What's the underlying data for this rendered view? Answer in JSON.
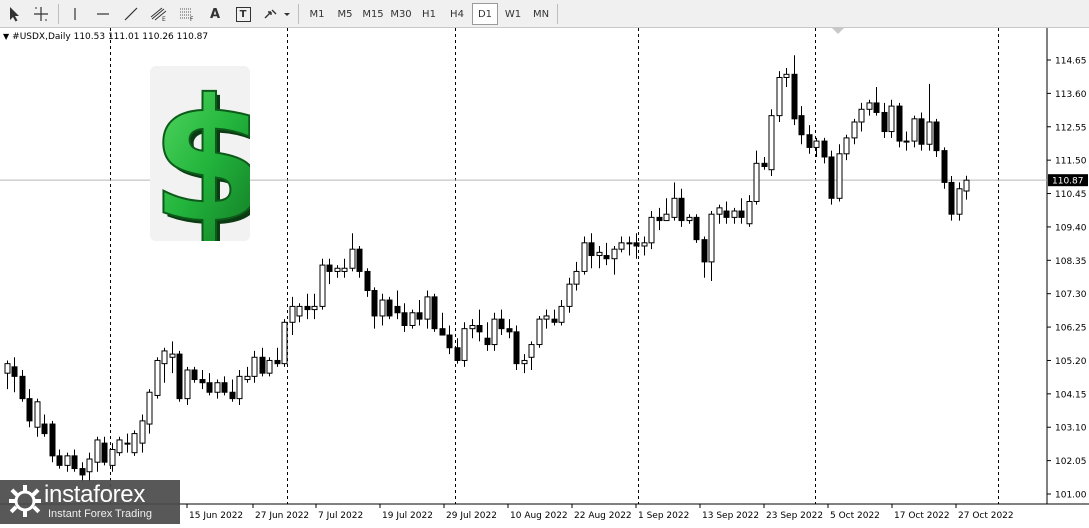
{
  "toolbar": {
    "tools": [
      {
        "icon": "cursor-arrow-icon"
      },
      {
        "icon": "crosshair-icon"
      },
      {
        "icon": "vertical-line-icon"
      },
      {
        "icon": "horizontal-line-icon"
      },
      {
        "icon": "trendline-icon"
      },
      {
        "icon": "equidistant-channel-icon"
      },
      {
        "icon": "fibonacci-icon"
      },
      {
        "icon": "text-icon",
        "label": "A"
      },
      {
        "icon": "text-label-icon",
        "label": "T"
      },
      {
        "icon": "arrows-dropdown-icon"
      }
    ],
    "timeframes": [
      "M1",
      "M5",
      "M15",
      "M30",
      "H1",
      "H4",
      "D1",
      "W1",
      "MN"
    ],
    "active_timeframe": "D1"
  },
  "symbol_info": "#USDX,Daily  110.53 111.01 110.26 110.87",
  "watermark": {
    "brand": "instaforex",
    "tagline": "Instant Forex Trading"
  },
  "colors": {
    "bull_body": "#ffffff",
    "bear_body": "#000000",
    "wick": "#000000",
    "price_tag_bg": "#000000",
    "price_tag_fg": "#ffffff",
    "dollar_green": "#22b43c"
  },
  "chart_data": {
    "type": "candlestick",
    "symbol": "#USDX",
    "timeframe": "Daily",
    "ohlc_current": {
      "open": 110.53,
      "high": 111.01,
      "low": 110.26,
      "close": 110.87
    },
    "ylim": [
      101.0,
      114.9
    ],
    "y_ticks": [
      101.0,
      102.05,
      103.1,
      104.15,
      105.2,
      106.25,
      107.3,
      108.35,
      109.4,
      110.45,
      111.5,
      112.55,
      113.6,
      114.65
    ],
    "y_tick_labels": [
      "101.00",
      "102.05",
      "103.10",
      "104.15",
      "105.20",
      "106.25",
      "107.30",
      "108.35",
      "109.40",
      "110.45",
      "111.50",
      "112.55",
      "113.60",
      "114.65"
    ],
    "current_price": "110.87",
    "x_tick_labels": [
      "15 Jun 2022",
      "27 Jun 2022",
      "7 Jul 2022",
      "19 Jul 2022",
      "29 Jul 2022",
      "10 Aug 2022",
      "22 Aug 2022",
      "1 Sep 2022",
      "13 Sep 2022",
      "23 Sep 2022",
      "5 Oct 2022",
      "17 Oct 2022",
      "27 Oct 2022"
    ],
    "grid": "off",
    "candles": [
      {
        "o": 104.8,
        "h": 105.2,
        "l": 104.3,
        "c": 105.1
      },
      {
        "o": 105.0,
        "h": 105.3,
        "l": 104.2,
        "c": 104.7
      },
      {
        "o": 104.7,
        "h": 104.9,
        "l": 103.9,
        "c": 104.0
      },
      {
        "o": 104.0,
        "h": 104.3,
        "l": 103.1,
        "c": 103.3
      },
      {
        "o": 103.1,
        "h": 104.0,
        "l": 102.8,
        "c": 103.9
      },
      {
        "o": 103.2,
        "h": 103.5,
        "l": 102.8,
        "c": 102.9
      },
      {
        "o": 103.2,
        "h": 103.3,
        "l": 102.0,
        "c": 102.2
      },
      {
        "o": 102.2,
        "h": 102.4,
        "l": 101.8,
        "c": 101.9
      },
      {
        "o": 101.9,
        "h": 102.3,
        "l": 101.7,
        "c": 102.2
      },
      {
        "o": 102.2,
        "h": 102.4,
        "l": 101.7,
        "c": 101.8
      },
      {
        "o": 101.8,
        "h": 102.0,
        "l": 101.4,
        "c": 101.6
      },
      {
        "o": 101.7,
        "h": 102.3,
        "l": 101.4,
        "c": 102.1
      },
      {
        "o": 102.0,
        "h": 102.8,
        "l": 101.7,
        "c": 102.7
      },
      {
        "o": 102.6,
        "h": 102.8,
        "l": 101.9,
        "c": 102.0
      },
      {
        "o": 101.9,
        "h": 102.6,
        "l": 101.7,
        "c": 102.4
      },
      {
        "o": 102.3,
        "h": 102.8,
        "l": 102.2,
        "c": 102.7
      },
      {
        "o": 102.6,
        "h": 102.9,
        "l": 102.3,
        "c": 102.6
      },
      {
        "o": 102.3,
        "h": 103.0,
        "l": 102.2,
        "c": 102.9
      },
      {
        "o": 102.6,
        "h": 103.5,
        "l": 102.3,
        "c": 103.3
      },
      {
        "o": 103.2,
        "h": 104.3,
        "l": 102.9,
        "c": 104.2
      },
      {
        "o": 104.1,
        "h": 105.3,
        "l": 104.0,
        "c": 105.2
      },
      {
        "o": 105.1,
        "h": 105.6,
        "l": 104.5,
        "c": 105.5
      },
      {
        "o": 105.3,
        "h": 105.8,
        "l": 104.8,
        "c": 105.4
      },
      {
        "o": 105.4,
        "h": 105.5,
        "l": 103.9,
        "c": 104.0
      },
      {
        "o": 104.0,
        "h": 105.0,
        "l": 103.8,
        "c": 104.9
      },
      {
        "o": 104.9,
        "h": 105.0,
        "l": 104.5,
        "c": 104.6
      },
      {
        "o": 104.6,
        "h": 104.9,
        "l": 104.3,
        "c": 104.5
      },
      {
        "o": 104.5,
        "h": 104.8,
        "l": 104.1,
        "c": 104.2
      },
      {
        "o": 104.2,
        "h": 104.6,
        "l": 104.0,
        "c": 104.5
      },
      {
        "o": 104.5,
        "h": 104.7,
        "l": 104.1,
        "c": 104.2
      },
      {
        "o": 104.2,
        "h": 104.6,
        "l": 103.9,
        "c": 104.0
      },
      {
        "o": 104.0,
        "h": 104.9,
        "l": 103.8,
        "c": 104.7
      },
      {
        "o": 104.6,
        "h": 105.0,
        "l": 104.5,
        "c": 104.7
      },
      {
        "o": 104.7,
        "h": 105.5,
        "l": 104.5,
        "c": 105.3
      },
      {
        "o": 105.3,
        "h": 105.6,
        "l": 104.7,
        "c": 104.8
      },
      {
        "o": 104.8,
        "h": 105.3,
        "l": 104.7,
        "c": 105.2
      },
      {
        "o": 105.2,
        "h": 105.6,
        "l": 105.0,
        "c": 105.1
      },
      {
        "o": 105.1,
        "h": 106.5,
        "l": 105.0,
        "c": 106.4
      },
      {
        "o": 106.4,
        "h": 107.2,
        "l": 106.0,
        "c": 106.9
      },
      {
        "o": 106.6,
        "h": 107.0,
        "l": 106.4,
        "c": 106.9
      },
      {
        "o": 106.9,
        "h": 107.3,
        "l": 106.5,
        "c": 106.8
      },
      {
        "o": 106.8,
        "h": 107.3,
        "l": 106.5,
        "c": 106.9
      },
      {
        "o": 106.9,
        "h": 108.4,
        "l": 106.8,
        "c": 108.2
      },
      {
        "o": 108.2,
        "h": 108.4,
        "l": 107.6,
        "c": 108.0
      },
      {
        "o": 108.0,
        "h": 108.2,
        "l": 107.8,
        "c": 108.1
      },
      {
        "o": 108.0,
        "h": 108.4,
        "l": 107.8,
        "c": 108.1
      },
      {
        "o": 108.1,
        "h": 109.2,
        "l": 108.0,
        "c": 108.7
      },
      {
        "o": 108.7,
        "h": 108.8,
        "l": 107.8,
        "c": 108.0
      },
      {
        "o": 108.0,
        "h": 108.1,
        "l": 107.2,
        "c": 107.4
      },
      {
        "o": 107.4,
        "h": 107.5,
        "l": 106.2,
        "c": 106.6
      },
      {
        "o": 106.6,
        "h": 107.3,
        "l": 106.3,
        "c": 107.1
      },
      {
        "o": 107.1,
        "h": 107.2,
        "l": 106.5,
        "c": 106.6
      },
      {
        "o": 106.9,
        "h": 107.4,
        "l": 106.5,
        "c": 106.7
      },
      {
        "o": 106.7,
        "h": 107.0,
        "l": 106.1,
        "c": 106.3
      },
      {
        "o": 106.3,
        "h": 106.8,
        "l": 106.2,
        "c": 106.7
      },
      {
        "o": 106.7,
        "h": 107.1,
        "l": 106.3,
        "c": 106.5
      },
      {
        "o": 106.5,
        "h": 107.4,
        "l": 106.2,
        "c": 107.2
      },
      {
        "o": 107.2,
        "h": 107.3,
        "l": 106.1,
        "c": 106.2
      },
      {
        "o": 106.2,
        "h": 106.7,
        "l": 106.0,
        "c": 106.0
      },
      {
        "o": 106.0,
        "h": 106.3,
        "l": 105.4,
        "c": 105.6
      },
      {
        "o": 105.6,
        "h": 105.9,
        "l": 105.1,
        "c": 105.2
      },
      {
        "o": 105.2,
        "h": 106.4,
        "l": 105.0,
        "c": 106.2
      },
      {
        "o": 106.2,
        "h": 106.5,
        "l": 105.9,
        "c": 106.3
      },
      {
        "o": 106.3,
        "h": 106.8,
        "l": 105.8,
        "c": 106.1
      },
      {
        "o": 105.9,
        "h": 106.4,
        "l": 105.5,
        "c": 105.7
      },
      {
        "o": 105.7,
        "h": 106.7,
        "l": 105.5,
        "c": 106.5
      },
      {
        "o": 106.5,
        "h": 106.8,
        "l": 106.0,
        "c": 106.2
      },
      {
        "o": 106.2,
        "h": 106.5,
        "l": 105.9,
        "c": 106.1
      },
      {
        "o": 106.1,
        "h": 106.3,
        "l": 104.9,
        "c": 105.1
      },
      {
        "o": 105.1,
        "h": 105.4,
        "l": 104.8,
        "c": 105.2
      },
      {
        "o": 105.3,
        "h": 105.8,
        "l": 104.9,
        "c": 105.7
      },
      {
        "o": 105.7,
        "h": 106.6,
        "l": 105.6,
        "c": 106.5
      },
      {
        "o": 106.5,
        "h": 106.8,
        "l": 106.2,
        "c": 106.6
      },
      {
        "o": 106.5,
        "h": 106.8,
        "l": 106.3,
        "c": 106.4
      },
      {
        "o": 106.4,
        "h": 107.1,
        "l": 106.3,
        "c": 106.9
      },
      {
        "o": 106.9,
        "h": 107.8,
        "l": 106.7,
        "c": 107.6
      },
      {
        "o": 107.6,
        "h": 108.3,
        "l": 107.4,
        "c": 108.0
      },
      {
        "o": 108.0,
        "h": 109.1,
        "l": 107.9,
        "c": 108.9
      },
      {
        "o": 108.9,
        "h": 109.2,
        "l": 108.1,
        "c": 108.5
      },
      {
        "o": 108.5,
        "h": 108.8,
        "l": 108.1,
        "c": 108.6
      },
      {
        "o": 108.5,
        "h": 108.9,
        "l": 108.2,
        "c": 108.4
      },
      {
        "o": 108.4,
        "h": 108.8,
        "l": 107.9,
        "c": 108.7
      },
      {
        "o": 108.7,
        "h": 109.1,
        "l": 108.6,
        "c": 108.9
      },
      {
        "o": 108.9,
        "h": 109.1,
        "l": 108.5,
        "c": 108.9
      },
      {
        "o": 108.9,
        "h": 109.2,
        "l": 108.4,
        "c": 108.8
      },
      {
        "o": 108.8,
        "h": 109.1,
        "l": 108.5,
        "c": 108.9
      },
      {
        "o": 108.9,
        "h": 109.9,
        "l": 108.7,
        "c": 109.7
      },
      {
        "o": 109.7,
        "h": 110.0,
        "l": 109.3,
        "c": 109.6
      },
      {
        "o": 109.6,
        "h": 110.3,
        "l": 109.6,
        "c": 109.8
      },
      {
        "o": 109.7,
        "h": 110.8,
        "l": 109.6,
        "c": 110.3
      },
      {
        "o": 110.3,
        "h": 110.6,
        "l": 109.4,
        "c": 109.6
      },
      {
        "o": 109.6,
        "h": 109.8,
        "l": 109.5,
        "c": 109.7
      },
      {
        "o": 109.7,
        "h": 109.8,
        "l": 108.9,
        "c": 109.0
      },
      {
        "o": 109.0,
        "h": 109.1,
        "l": 107.8,
        "c": 108.3
      },
      {
        "o": 108.3,
        "h": 109.9,
        "l": 107.7,
        "c": 109.8
      },
      {
        "o": 109.8,
        "h": 110.1,
        "l": 109.5,
        "c": 110.0
      },
      {
        "o": 109.9,
        "h": 110.2,
        "l": 109.5,
        "c": 109.7
      },
      {
        "o": 109.7,
        "h": 110.0,
        "l": 109.5,
        "c": 109.9
      },
      {
        "o": 109.9,
        "h": 110.3,
        "l": 109.5,
        "c": 109.7
      },
      {
        "o": 109.5,
        "h": 110.4,
        "l": 109.4,
        "c": 110.2
      },
      {
        "o": 110.2,
        "h": 111.8,
        "l": 110.1,
        "c": 111.4
      },
      {
        "o": 111.4,
        "h": 111.6,
        "l": 111.2,
        "c": 111.3
      },
      {
        "o": 111.2,
        "h": 113.1,
        "l": 111.0,
        "c": 112.9
      },
      {
        "o": 112.9,
        "h": 114.3,
        "l": 112.7,
        "c": 114.1
      },
      {
        "o": 114.1,
        "h": 114.4,
        "l": 113.8,
        "c": 114.2
      },
      {
        "o": 114.2,
        "h": 114.8,
        "l": 112.6,
        "c": 112.8
      },
      {
        "o": 112.9,
        "h": 113.2,
        "l": 112.0,
        "c": 112.3
      },
      {
        "o": 112.3,
        "h": 112.6,
        "l": 111.7,
        "c": 111.9
      },
      {
        "o": 111.9,
        "h": 112.2,
        "l": 111.6,
        "c": 112.1
      },
      {
        "o": 112.1,
        "h": 112.2,
        "l": 111.4,
        "c": 111.6
      },
      {
        "o": 111.6,
        "h": 111.8,
        "l": 110.1,
        "c": 110.3
      },
      {
        "o": 110.3,
        "h": 112.0,
        "l": 110.2,
        "c": 111.7
      },
      {
        "o": 111.7,
        "h": 112.3,
        "l": 111.5,
        "c": 112.2
      },
      {
        "o": 112.2,
        "h": 112.8,
        "l": 112.0,
        "c": 112.7
      },
      {
        "o": 112.7,
        "h": 113.3,
        "l": 112.4,
        "c": 113.1
      },
      {
        "o": 113.1,
        "h": 113.4,
        "l": 112.9,
        "c": 113.3
      },
      {
        "o": 113.3,
        "h": 113.8,
        "l": 112.9,
        "c": 113.0
      },
      {
        "o": 113.0,
        "h": 113.3,
        "l": 112.2,
        "c": 112.4
      },
      {
        "o": 112.4,
        "h": 113.4,
        "l": 112.2,
        "c": 113.2
      },
      {
        "o": 113.2,
        "h": 113.3,
        "l": 111.9,
        "c": 112.1
      },
      {
        "o": 112.1,
        "h": 112.4,
        "l": 111.8,
        "c": 112.1
      },
      {
        "o": 112.1,
        "h": 112.9,
        "l": 111.9,
        "c": 112.8
      },
      {
        "o": 112.8,
        "h": 113.0,
        "l": 111.8,
        "c": 112.0
      },
      {
        "o": 112.0,
        "h": 113.9,
        "l": 111.8,
        "c": 112.7
      },
      {
        "o": 112.7,
        "h": 112.8,
        "l": 111.6,
        "c": 111.8
      },
      {
        "o": 111.8,
        "h": 111.9,
        "l": 110.6,
        "c": 110.8
      },
      {
        "o": 110.8,
        "h": 111.0,
        "l": 109.6,
        "c": 109.8
      },
      {
        "o": 109.8,
        "h": 110.8,
        "l": 109.6,
        "c": 110.6
      },
      {
        "o": 110.53,
        "h": 111.01,
        "l": 110.26,
        "c": 110.87
      }
    ]
  }
}
